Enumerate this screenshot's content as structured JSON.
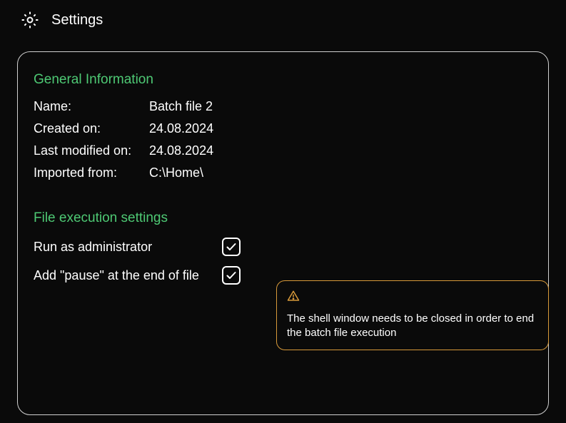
{
  "header": {
    "title": "Settings"
  },
  "general": {
    "section_title": "General Information",
    "name_label": "Name:",
    "name_value": "Batch file 2",
    "created_label": "Created on:",
    "created_value": "24.08.2024",
    "modified_label": "Last modified on:",
    "modified_value": "24.08.2024",
    "imported_label": "Imported from:",
    "imported_value": "C:\\Home\\"
  },
  "exec": {
    "section_title": "File execution settings",
    "admin_label": "Run as administrator",
    "admin_checked": true,
    "pause_label": "Add \"pause\" at the end of file",
    "pause_checked": true
  },
  "warning": {
    "text": "The shell window needs to be closed in order to end the batch file execution"
  },
  "colors": {
    "accent_green": "#4ec974",
    "warning_border": "#d89a3a",
    "panel_border": "#d0d0d0",
    "bg": "#0a0a0a"
  }
}
